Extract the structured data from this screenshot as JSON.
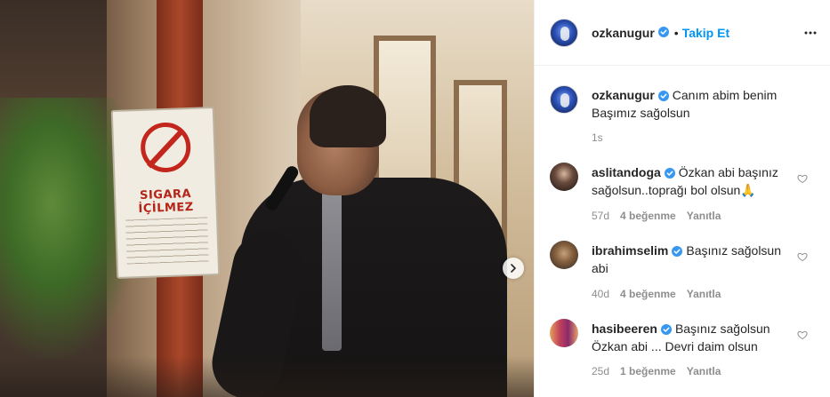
{
  "post": {
    "author": "ozkanugur",
    "follow_label": "Takip Et",
    "separator": "•",
    "caption_line1": "Canım abim benim",
    "caption_line2": "Başımız sağolsun",
    "caption_time": "1s"
  },
  "media": {
    "sign_text": "SIGARA İÇİLMEZ"
  },
  "comments": [
    {
      "username": "aslitandoga",
      "line1": "Özkan abi başınız",
      "line2": "sağolsun..toprağı bol olsun🙏",
      "time": "57d",
      "likes": "4 beğenme",
      "reply": "Yanıtla"
    },
    {
      "username": "ibrahimselim",
      "line1": "Başınız sağolsun",
      "line2": "abi",
      "time": "40d",
      "likes": "4 beğenme",
      "reply": "Yanıtla"
    },
    {
      "username": "hasibeeren",
      "line1": "Başınız sağolsun",
      "line2": "Özkan abi ... Devri daim olsun",
      "time": "25d",
      "likes": "1 beğenme",
      "reply": "Yanıtla"
    }
  ],
  "colors": {
    "accent": "#0095f6",
    "text": "#262626",
    "muted": "#8e8e8e",
    "verified": "#3897f0"
  }
}
